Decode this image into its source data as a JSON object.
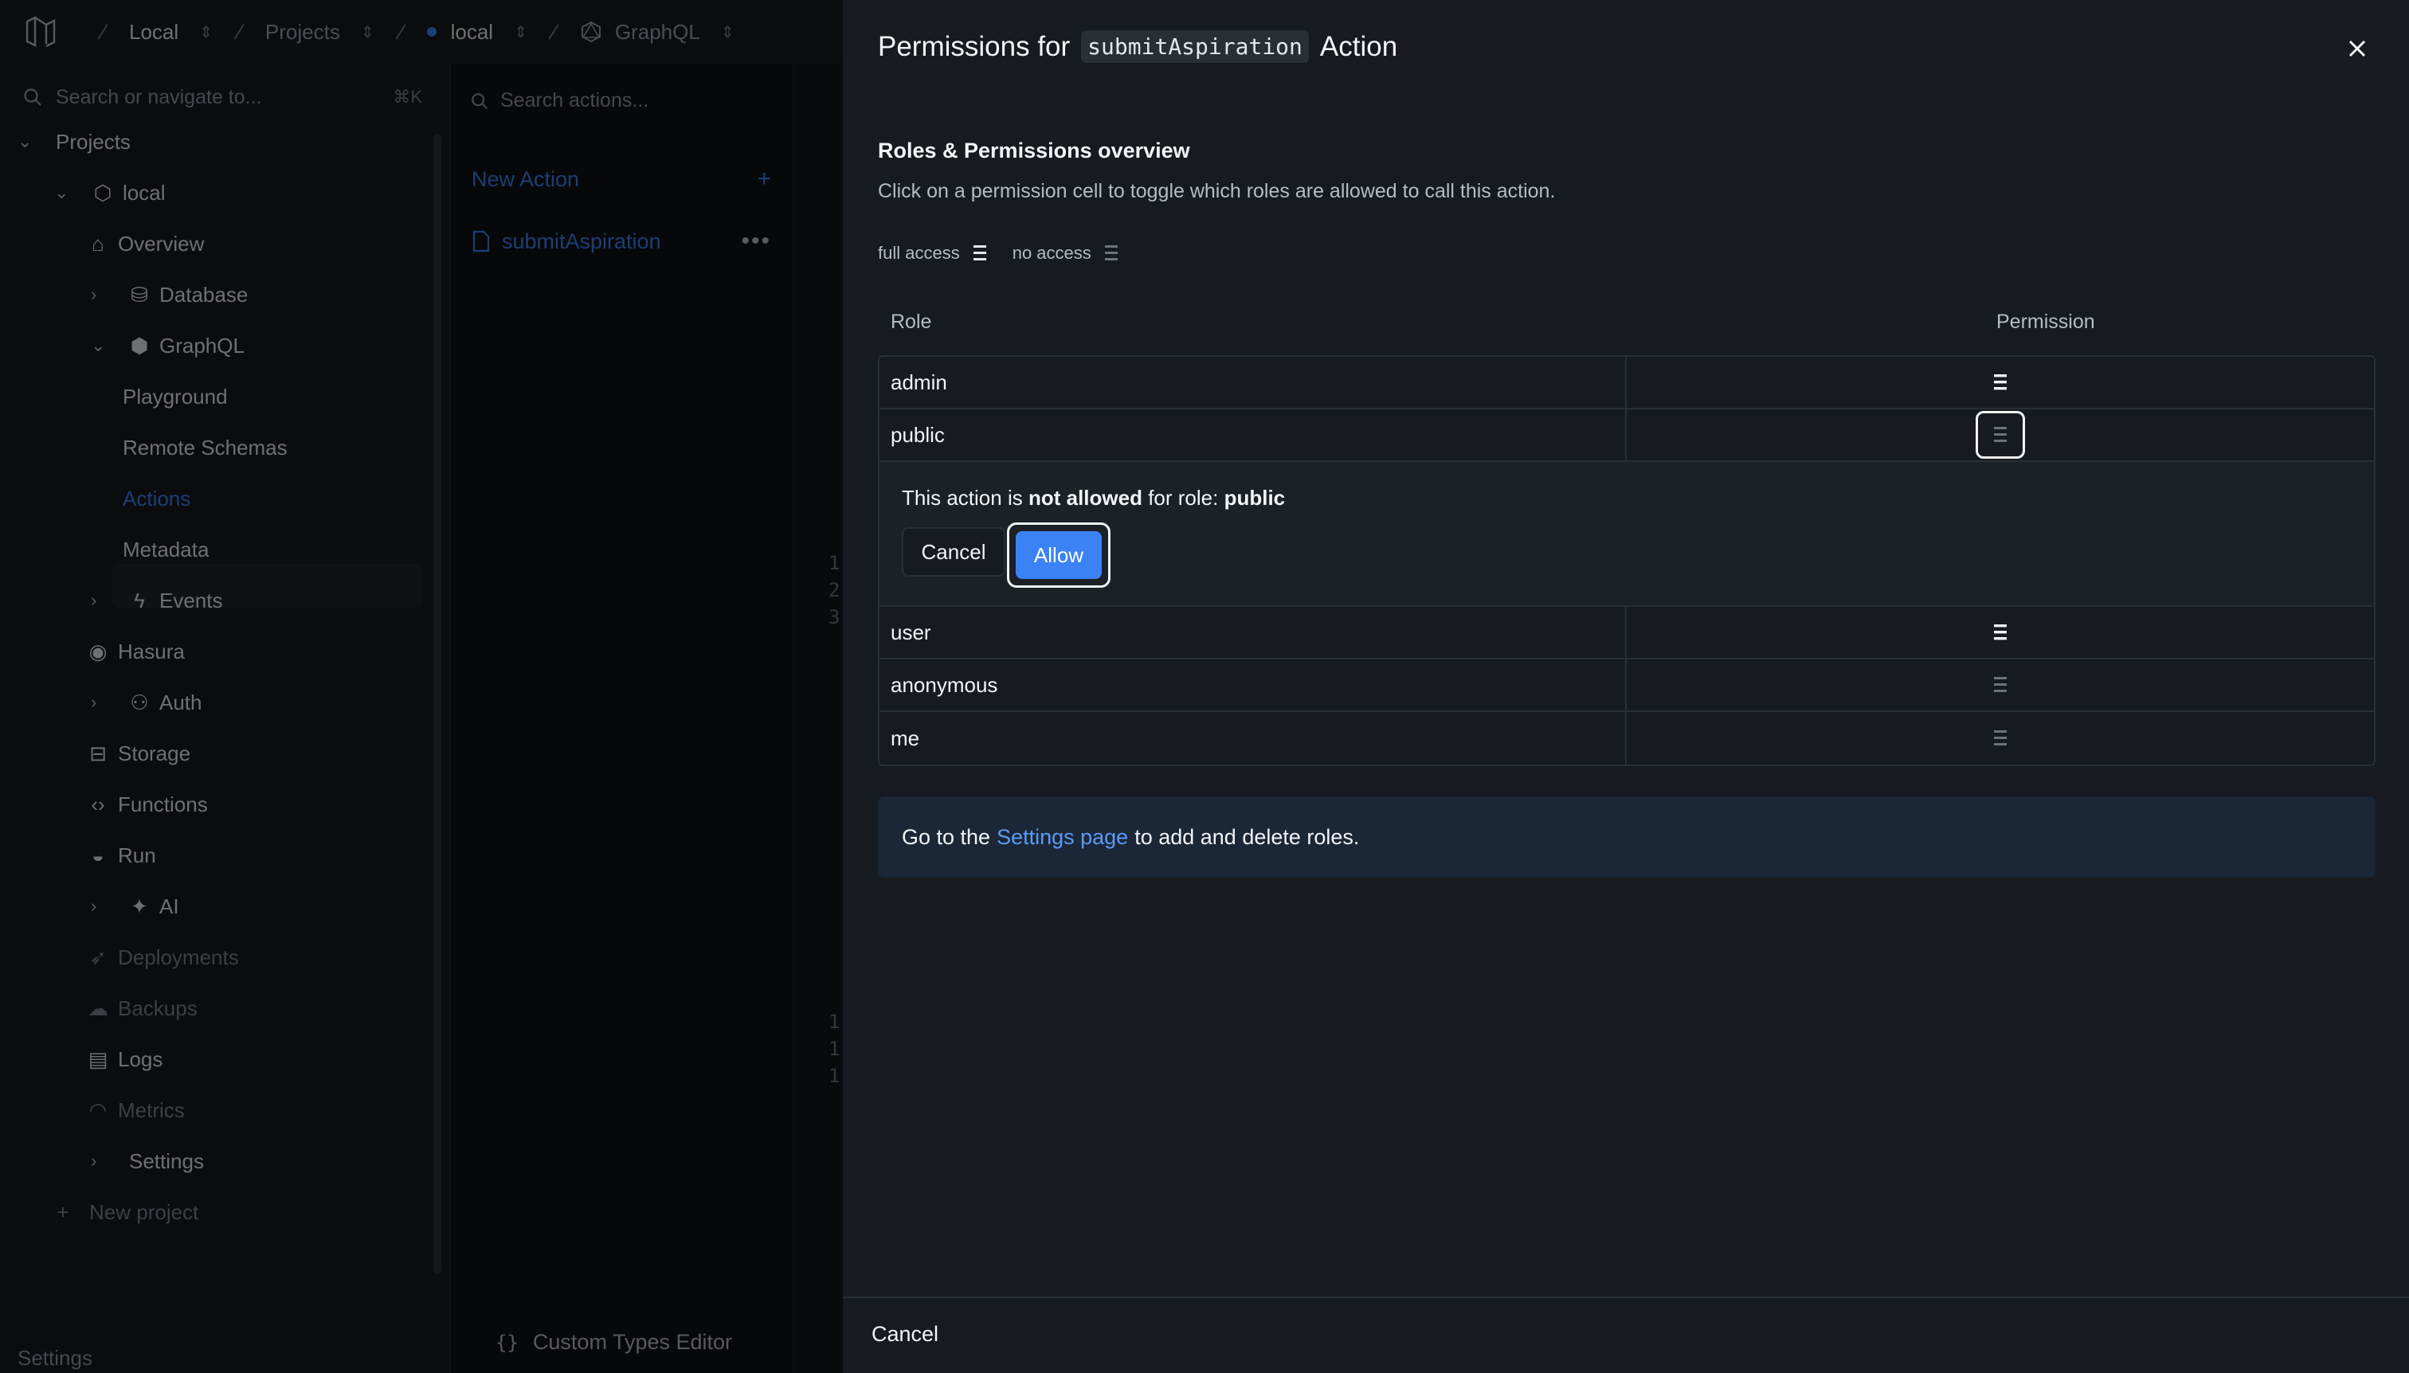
{
  "topbar": {
    "crumbs": [
      "Local",
      "Projects",
      "local",
      "GraphQL"
    ]
  },
  "sidebar": {
    "search_placeholder": "Search or navigate to...",
    "search_shortcut": "⌘K",
    "items": {
      "projects": "Projects",
      "local": "local",
      "overview": "Overview",
      "database": "Database",
      "graphql": "GraphQL",
      "playground": "Playground",
      "remote_schemas": "Remote Schemas",
      "actions": "Actions",
      "metadata": "Metadata",
      "events": "Events",
      "hasura": "Hasura",
      "auth": "Auth",
      "storage": "Storage",
      "functions": "Functions",
      "run": "Run",
      "ai": "AI",
      "deployments": "Deployments",
      "backups": "Backups",
      "logs": "Logs",
      "metrics": "Metrics",
      "settings": "Settings",
      "new_project": "New project"
    },
    "footer_settings": "Settings"
  },
  "actions_panel": {
    "search_placeholder": "Search actions...",
    "new_action": "New Action",
    "items": [
      "submitAspiration"
    ],
    "custom_types_editor": "Custom Types Editor"
  },
  "editor": {
    "line_numbers_top": [
      "1",
      "2",
      "3"
    ],
    "line_numbers_bottom": [
      "1",
      "1",
      "1"
    ]
  },
  "drawer": {
    "title_prefix": "Permissions for",
    "title_code": "submitAspiration",
    "title_suffix": "Action",
    "section_title": "Roles & Permissions overview",
    "section_desc": "Click on a permission cell to toggle which roles are allowed to call this action.",
    "legend_full": "full access",
    "legend_none": "no access",
    "col_role": "Role",
    "col_permission": "Permission",
    "roles": [
      {
        "name": "admin",
        "access": "full"
      },
      {
        "name": "public",
        "access": "none"
      },
      {
        "name": "user",
        "access": "full"
      },
      {
        "name": "anonymous",
        "access": "none"
      },
      {
        "name": "me",
        "access": "none"
      }
    ],
    "confirm": {
      "msg_prefix": "This action is",
      "msg_status": "not allowed",
      "msg_mid": "for role:",
      "msg_role": "public",
      "cancel": "Cancel",
      "allow": "Allow"
    },
    "info_prefix": "Go to the",
    "info_link": "Settings page",
    "info_suffix": "to add and delete roles.",
    "footer_cancel": "Cancel"
  },
  "colors": {
    "accent": "#3b82f6",
    "drawer_bg": "#171a20",
    "info_bg": "#1b2636"
  }
}
